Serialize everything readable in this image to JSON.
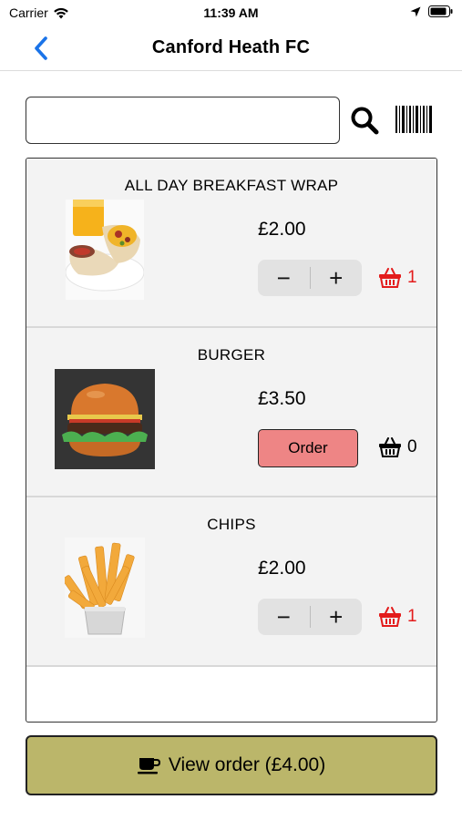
{
  "status_bar": {
    "carrier": "Carrier",
    "time": "11:39 AM",
    "icons": [
      "wifi-icon",
      "location-arrow-icon",
      "battery-icon"
    ]
  },
  "nav": {
    "title": "Canford Heath FC",
    "back_icon": "chevron-left-icon",
    "accent_color": "#1a73e8"
  },
  "search": {
    "value": "",
    "placeholder": "",
    "search_icon": "search-icon",
    "barcode_icon": "barcode-icon"
  },
  "products": [
    {
      "name": "ALL DAY BREAKFAST WRAP",
      "price": "£2.00",
      "in_basket": true,
      "quantity": "1",
      "minus_label": "−",
      "plus_label": "+",
      "image": "breakfast-wrap-image"
    },
    {
      "name": "BURGER",
      "price": "£3.50",
      "in_basket": false,
      "quantity": "0",
      "order_label": "Order",
      "image": "burger-image"
    },
    {
      "name": "CHIPS",
      "price": "£2.00",
      "in_basket": true,
      "quantity": "1",
      "minus_label": "−",
      "plus_label": "+",
      "image": "chips-image"
    }
  ],
  "colors": {
    "basket_active": "#e31b1b",
    "order_button": "#ee8585",
    "view_order_button": "#bbb66a"
  },
  "footer": {
    "view_order_label": "View order (£4.00)",
    "icon": "coffee-cup-icon"
  }
}
